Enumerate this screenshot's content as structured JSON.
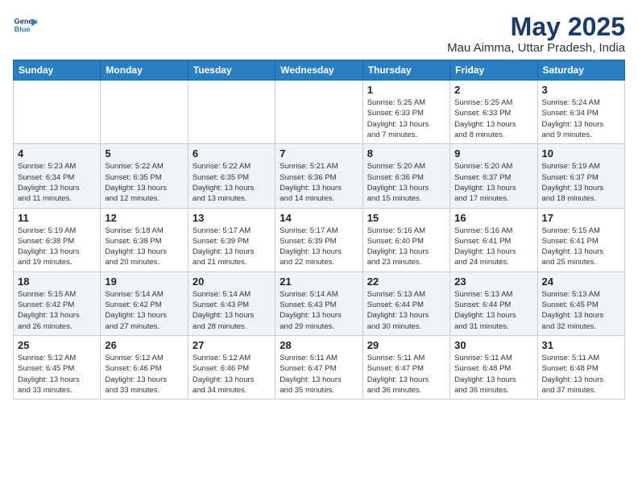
{
  "header": {
    "logo_general": "General",
    "logo_blue": "Blue",
    "title": "May 2025",
    "subtitle": "Mau Aimma, Uttar Pradesh, India"
  },
  "weekdays": [
    "Sunday",
    "Monday",
    "Tuesday",
    "Wednesday",
    "Thursday",
    "Friday",
    "Saturday"
  ],
  "weeks": [
    [
      {
        "day": "",
        "info": ""
      },
      {
        "day": "",
        "info": ""
      },
      {
        "day": "",
        "info": ""
      },
      {
        "day": "",
        "info": ""
      },
      {
        "day": "1",
        "info": "Sunrise: 5:25 AM\nSunset: 6:33 PM\nDaylight: 13 hours\nand 7 minutes."
      },
      {
        "day": "2",
        "info": "Sunrise: 5:25 AM\nSunset: 6:33 PM\nDaylight: 13 hours\nand 8 minutes."
      },
      {
        "day": "3",
        "info": "Sunrise: 5:24 AM\nSunset: 6:34 PM\nDaylight: 13 hours\nand 9 minutes."
      }
    ],
    [
      {
        "day": "4",
        "info": "Sunrise: 5:23 AM\nSunset: 6:34 PM\nDaylight: 13 hours\nand 11 minutes."
      },
      {
        "day": "5",
        "info": "Sunrise: 5:22 AM\nSunset: 6:35 PM\nDaylight: 13 hours\nand 12 minutes."
      },
      {
        "day": "6",
        "info": "Sunrise: 5:22 AM\nSunset: 6:35 PM\nDaylight: 13 hours\nand 13 minutes."
      },
      {
        "day": "7",
        "info": "Sunrise: 5:21 AM\nSunset: 6:36 PM\nDaylight: 13 hours\nand 14 minutes."
      },
      {
        "day": "8",
        "info": "Sunrise: 5:20 AM\nSunset: 6:36 PM\nDaylight: 13 hours\nand 15 minutes."
      },
      {
        "day": "9",
        "info": "Sunrise: 5:20 AM\nSunset: 6:37 PM\nDaylight: 13 hours\nand 17 minutes."
      },
      {
        "day": "10",
        "info": "Sunrise: 5:19 AM\nSunset: 6:37 PM\nDaylight: 13 hours\nand 18 minutes."
      }
    ],
    [
      {
        "day": "11",
        "info": "Sunrise: 5:19 AM\nSunset: 6:38 PM\nDaylight: 13 hours\nand 19 minutes."
      },
      {
        "day": "12",
        "info": "Sunrise: 5:18 AM\nSunset: 6:38 PM\nDaylight: 13 hours\nand 20 minutes."
      },
      {
        "day": "13",
        "info": "Sunrise: 5:17 AM\nSunset: 6:39 PM\nDaylight: 13 hours\nand 21 minutes."
      },
      {
        "day": "14",
        "info": "Sunrise: 5:17 AM\nSunset: 6:39 PM\nDaylight: 13 hours\nand 22 minutes."
      },
      {
        "day": "15",
        "info": "Sunrise: 5:16 AM\nSunset: 6:40 PM\nDaylight: 13 hours\nand 23 minutes."
      },
      {
        "day": "16",
        "info": "Sunrise: 5:16 AM\nSunset: 6:41 PM\nDaylight: 13 hours\nand 24 minutes."
      },
      {
        "day": "17",
        "info": "Sunrise: 5:15 AM\nSunset: 6:41 PM\nDaylight: 13 hours\nand 25 minutes."
      }
    ],
    [
      {
        "day": "18",
        "info": "Sunrise: 5:15 AM\nSunset: 6:42 PM\nDaylight: 13 hours\nand 26 minutes."
      },
      {
        "day": "19",
        "info": "Sunrise: 5:14 AM\nSunset: 6:42 PM\nDaylight: 13 hours\nand 27 minutes."
      },
      {
        "day": "20",
        "info": "Sunrise: 5:14 AM\nSunset: 6:43 PM\nDaylight: 13 hours\nand 28 minutes."
      },
      {
        "day": "21",
        "info": "Sunrise: 5:14 AM\nSunset: 6:43 PM\nDaylight: 13 hours\nand 29 minutes."
      },
      {
        "day": "22",
        "info": "Sunrise: 5:13 AM\nSunset: 6:44 PM\nDaylight: 13 hours\nand 30 minutes."
      },
      {
        "day": "23",
        "info": "Sunrise: 5:13 AM\nSunset: 6:44 PM\nDaylight: 13 hours\nand 31 minutes."
      },
      {
        "day": "24",
        "info": "Sunrise: 5:13 AM\nSunset: 6:45 PM\nDaylight: 13 hours\nand 32 minutes."
      }
    ],
    [
      {
        "day": "25",
        "info": "Sunrise: 5:12 AM\nSunset: 6:45 PM\nDaylight: 13 hours\nand 33 minutes."
      },
      {
        "day": "26",
        "info": "Sunrise: 5:12 AM\nSunset: 6:46 PM\nDaylight: 13 hours\nand 33 minutes."
      },
      {
        "day": "27",
        "info": "Sunrise: 5:12 AM\nSunset: 6:46 PM\nDaylight: 13 hours\nand 34 minutes."
      },
      {
        "day": "28",
        "info": "Sunrise: 5:11 AM\nSunset: 6:47 PM\nDaylight: 13 hours\nand 35 minutes."
      },
      {
        "day": "29",
        "info": "Sunrise: 5:11 AM\nSunset: 6:47 PM\nDaylight: 13 hours\nand 36 minutes."
      },
      {
        "day": "30",
        "info": "Sunrise: 5:11 AM\nSunset: 6:48 PM\nDaylight: 13 hours\nand 36 minutes."
      },
      {
        "day": "31",
        "info": "Sunrise: 5:11 AM\nSunset: 6:48 PM\nDaylight: 13 hours\nand 37 minutes."
      }
    ]
  ]
}
